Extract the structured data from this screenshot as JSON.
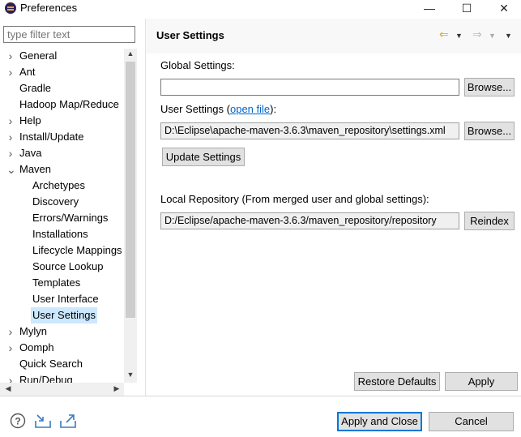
{
  "window": {
    "title": "Preferences",
    "controls": [
      "—",
      "☐",
      "✕"
    ]
  },
  "filter": {
    "placeholder": "type filter text"
  },
  "tree": [
    {
      "label": "General",
      "level": 0,
      "twisty": "›"
    },
    {
      "label": "Ant",
      "level": 0,
      "twisty": "›"
    },
    {
      "label": "Gradle",
      "level": 0,
      "twisty": ""
    },
    {
      "label": "Hadoop Map/Reduce",
      "level": 0,
      "twisty": ""
    },
    {
      "label": "Help",
      "level": 0,
      "twisty": "›"
    },
    {
      "label": "Install/Update",
      "level": 0,
      "twisty": "›"
    },
    {
      "label": "Java",
      "level": 0,
      "twisty": "›"
    },
    {
      "label": "Maven",
      "level": 0,
      "twisty": "⌄"
    },
    {
      "label": "Archetypes",
      "level": 1,
      "twisty": ""
    },
    {
      "label": "Discovery",
      "level": 1,
      "twisty": ""
    },
    {
      "label": "Errors/Warnings",
      "level": 1,
      "twisty": ""
    },
    {
      "label": "Installations",
      "level": 1,
      "twisty": ""
    },
    {
      "label": "Lifecycle Mappings",
      "level": 1,
      "twisty": ""
    },
    {
      "label": "Source Lookup",
      "level": 1,
      "twisty": ""
    },
    {
      "label": "Templates",
      "level": 1,
      "twisty": ""
    },
    {
      "label": "User Interface",
      "level": 1,
      "twisty": ""
    },
    {
      "label": "User Settings",
      "level": 1,
      "twisty": "",
      "selected": true
    },
    {
      "label": "Mylyn",
      "level": 0,
      "twisty": "›"
    },
    {
      "label": "Oomph",
      "level": 0,
      "twisty": "›"
    },
    {
      "label": "Quick Search",
      "level": 0,
      "twisty": ""
    },
    {
      "label": "Run/Debug",
      "level": 0,
      "twisty": "›"
    }
  ],
  "page": {
    "title": "User Settings",
    "global_label": "Global Settings:",
    "global_value": "",
    "browse_label": "Browse...",
    "user_label_prefix": "User Settings (",
    "open_file": "open file",
    "user_label_suffix": "):",
    "user_value": "D:\\Eclipse\\apache-maven-3.6.3\\maven_repository\\settings.xml",
    "update_label": "Update Settings",
    "local_repo_label": "Local Repository (From merged user and global settings):",
    "local_repo_value": "D:/Eclipse/apache-maven-3.6.3/maven_repository/repository",
    "reindex_label": "Reindex",
    "restore_label": "Restore Defaults",
    "apply_label": "Apply"
  },
  "footer": {
    "apply_close_label": "Apply and Close",
    "cancel_label": "Cancel"
  },
  "icons": {
    "help": "help-icon",
    "import": "import-icon",
    "export": "export-icon",
    "back": "back-arrow-icon",
    "forward": "forward-arrow-icon",
    "menu": "view-menu-icon"
  },
  "colors": {
    "accent": "#0078d7",
    "selection": "#cce8ff",
    "link": "#0066cc"
  }
}
